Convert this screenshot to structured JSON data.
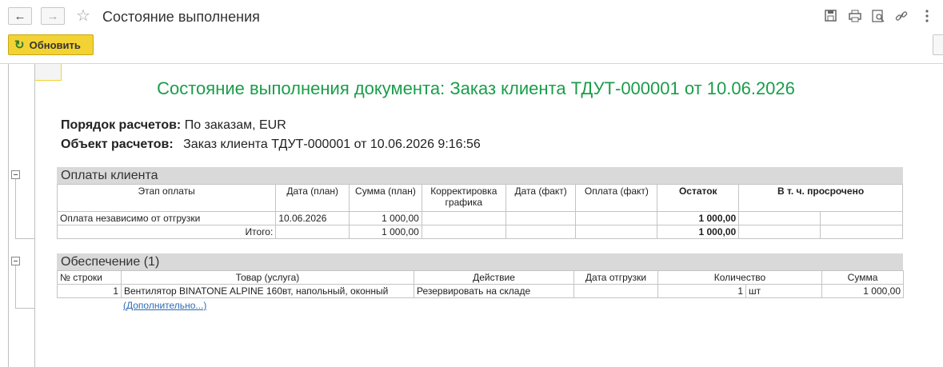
{
  "window": {
    "title": "Состояние выполнения",
    "refresh_label": "Обновить"
  },
  "report": {
    "title": "Состояние выполнения документа: Заказ клиента ТДУТ-000001 от 10.06.2026",
    "payment_order_label": "Порядок расчетов:",
    "payment_order_value": "По заказам, EUR",
    "settlement_object_label": "Объект расчетов:",
    "settlement_object_value": "Заказ клиента ТДУТ-000001 от 10.06.2026 9:16:56"
  },
  "payments": {
    "section_title": "Оплаты клиента",
    "headers": [
      "Этап оплаты",
      "Дата (план)",
      "Сумма (план)",
      "Корректировка графика",
      "Дата (факт)",
      "Оплата (факт)",
      "Остаток",
      "В т. ч. просрочено"
    ],
    "row": {
      "stage": "Оплата независимо от отгрузки",
      "date_plan": "10.06.2026",
      "sum_plan": "1 000,00",
      "balance": "1 000,00"
    },
    "total": {
      "label": "Итого:",
      "sum_plan": "1 000,00",
      "balance": "1 000,00"
    }
  },
  "supply": {
    "section_title": "Обеспечение (1)",
    "headers": [
      "№ строки",
      "Товар (услуга)",
      "Действие",
      "Дата отгрузки",
      "Количество",
      "Сумма"
    ],
    "row": {
      "line_no": "1",
      "item": "Вентилятор BINATONE ALPINE 160вт, напольный, оконный",
      "action": "Резервировать на складе",
      "ship_date": "",
      "qty": "1",
      "unit": "шт",
      "sum": "1 000,00"
    },
    "more_link": "(Дополнительно...)"
  }
}
